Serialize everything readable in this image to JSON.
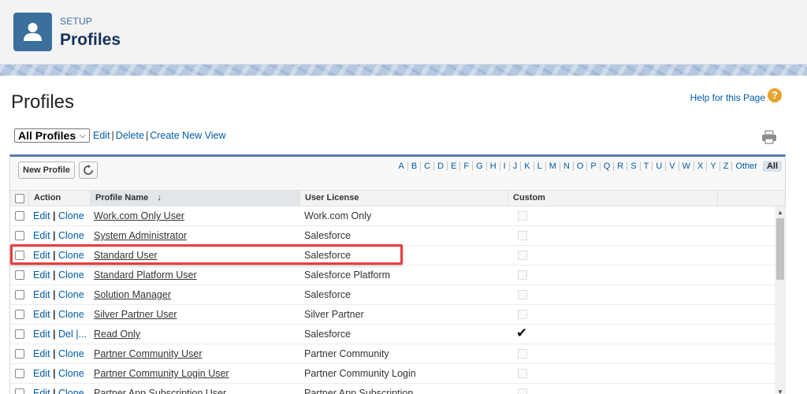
{
  "header": {
    "setup_label": "SETUP",
    "title": "Profiles"
  },
  "page": {
    "title": "Profiles",
    "help_link": "Help for this Page",
    "help_icon": "?"
  },
  "view": {
    "selected": "All Profiles",
    "links": {
      "edit": "Edit",
      "delete": "Delete",
      "create": "Create New View"
    }
  },
  "toolbar": {
    "new_button": "New Profile"
  },
  "alphabet": [
    "A",
    "B",
    "C",
    "D",
    "E",
    "F",
    "G",
    "H",
    "I",
    "J",
    "K",
    "L",
    "M",
    "N",
    "O",
    "P",
    "Q",
    "R",
    "S",
    "T",
    "U",
    "V",
    "W",
    "X",
    "Y",
    "Z",
    "Other"
  ],
  "alphabet_all": "All",
  "table": {
    "columns": {
      "action": "Action",
      "name": "Profile Name",
      "sort_indicator": "↓",
      "license": "User License",
      "custom": "Custom"
    },
    "rows": [
      {
        "a1": "Edit",
        "a2": "Clone",
        "name": "Work.com Only User",
        "license": "Work.com Only",
        "custom": false
      },
      {
        "a1": "Edit",
        "a2": "Clone",
        "name": "System Administrator",
        "license": "Salesforce",
        "custom": false
      },
      {
        "a1": "Edit",
        "a2": "Clone",
        "name": "Standard User",
        "license": "Salesforce",
        "custom": false
      },
      {
        "a1": "Edit",
        "a2": "Clone",
        "name": "Standard Platform User",
        "license": "Salesforce Platform",
        "custom": false
      },
      {
        "a1": "Edit",
        "a2": "Clone",
        "name": "Solution Manager",
        "license": "Salesforce",
        "custom": false
      },
      {
        "a1": "Edit",
        "a2": "Clone",
        "name": "Silver Partner User",
        "license": "Silver Partner",
        "custom": false
      },
      {
        "a1": "Edit",
        "a2": "Del |...",
        "name": "Read Only",
        "license": "Salesforce",
        "custom": true
      },
      {
        "a1": "Edit",
        "a2": "Clone",
        "name": "Partner Community User",
        "license": "Partner Community",
        "custom": false
      },
      {
        "a1": "Edit",
        "a2": "Clone",
        "name": "Partner Community Login User",
        "license": "Partner Community Login",
        "custom": false
      },
      {
        "a1": "Edit",
        "a2": "Clone",
        "name": "Partner App Subscription User",
        "license": "Partner App Subscription",
        "custom": false
      }
    ]
  },
  "highlighted_row": "Standard User",
  "colors": {
    "link": "#015ba7",
    "header_icon": "#3b6f9c",
    "highlight": "#e83d3d",
    "panel_accent": "#5b7ca8"
  },
  "icons": {
    "header": "user-icon",
    "help": "help-icon",
    "print": "printer-icon",
    "refresh": "refresh-icon",
    "check": "checkmark-icon"
  }
}
